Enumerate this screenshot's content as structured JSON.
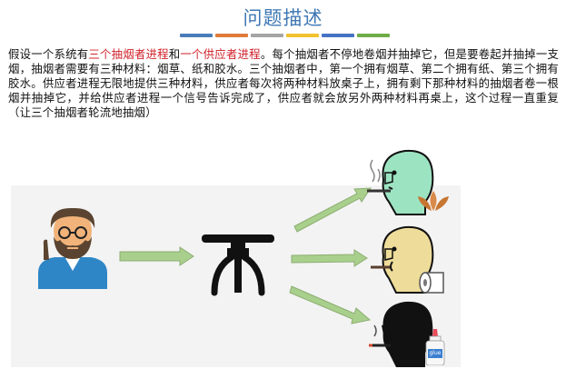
{
  "slide": {
    "title": "问题描述",
    "accent_colors": [
      "#4a7db8",
      "#e07b39",
      "#a5a5a5",
      "#f2c230",
      "#4472c4",
      "#70ad47"
    ],
    "paragraph": {
      "p1": "假设一个系统有",
      "h1": "三个抽烟者进程",
      "p2": "和",
      "h2": "一个供应者进程",
      "p3": "。每个抽烟者不停地卷烟并抽掉它，但是要卷起并抽掉一支烟，抽烟者需要有三种材料：烟草、纸和胶水。三个抽烟者中，第一个拥有烟草、第二个拥有纸、第三个拥有胶水。供应者进程无限地提供三种材料，供应者每次将两种材料放桌子上，拥有剩下那种材料的抽烟者卷一根烟并抽掉它，并给供应者进程一个信号告诉完成了，供应者就会放另外两种材料再桌上，这个过程一直重复（让三个抽烟者轮流地抽烟）"
    },
    "illustration": {
      "supplier": "supplier-person-icon",
      "table": "table-icon",
      "smokers": [
        "smoker-green-face-icon",
        "smoker-tan-face-icon",
        "smoker-black-face-icon"
      ],
      "items": [
        "tobacco-leaf-icon",
        "paper-roll-icon",
        "glue-bottle-icon"
      ],
      "glue_label": "glue",
      "arrow_color": "#a9cf8c"
    }
  }
}
